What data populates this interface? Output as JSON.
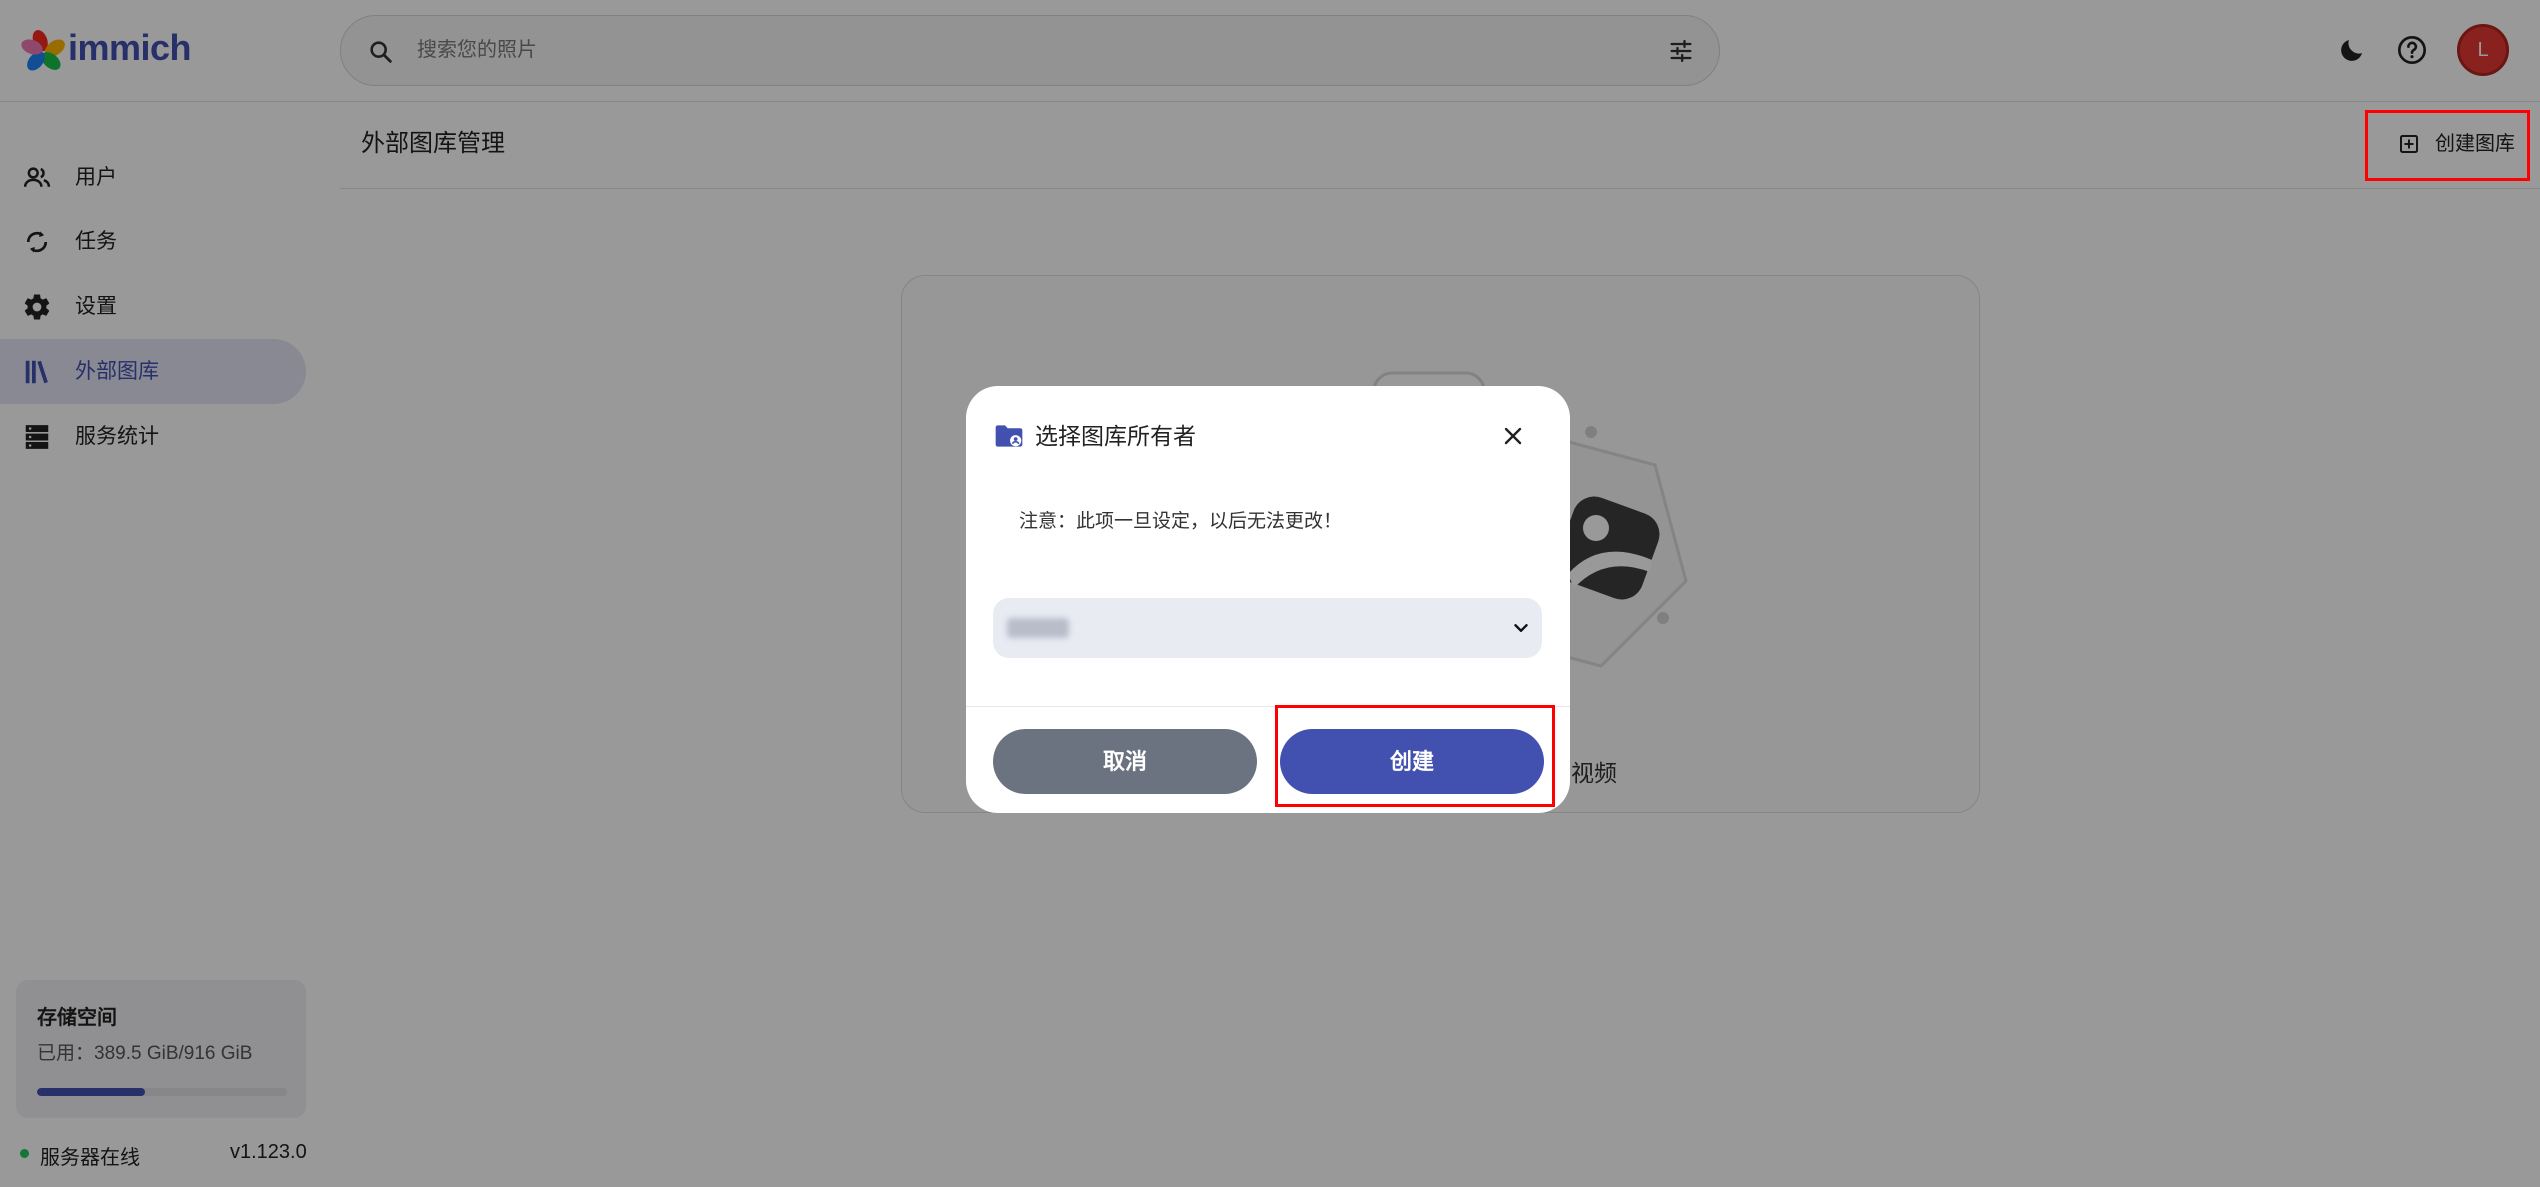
{
  "app": {
    "logo_text": "immich",
    "logo_icon": "immich-pinwheel-logo"
  },
  "header": {
    "search_placeholder": "搜索您的照片",
    "search_icon": "search-icon",
    "filter_icon": "tune-icon",
    "theme_icon": "moon-icon",
    "help_icon": "help-icon",
    "avatar_initial": "L"
  },
  "sidebar": {
    "items": [
      {
        "label": "用户",
        "icon": "users-icon",
        "active": false
      },
      {
        "label": "任务",
        "icon": "sync-icon",
        "active": false
      },
      {
        "label": "设置",
        "icon": "gear-icon",
        "active": false
      },
      {
        "label": "外部图库",
        "icon": "library-icon",
        "active": true
      },
      {
        "label": "服务统计",
        "icon": "server-icon",
        "active": false
      }
    ],
    "storage": {
      "title": "存储空间",
      "usage": "已用：389.5 GiB/916 GiB",
      "used_fraction": 0.43
    },
    "status": {
      "server": "服务器在线",
      "version": "v1.123.0"
    }
  },
  "main": {
    "title": "外部图库管理",
    "create_library_label": "创建图库",
    "empty_text_visible": "视频"
  },
  "modal": {
    "title": "选择图库所有者",
    "note": "注意：此项一旦设定，以后无法更改！",
    "cancel_label": "取消",
    "create_label": "创建"
  },
  "colors": {
    "accent": "#4250af",
    "cancel_button": "#6b7280",
    "avatar": "#e53935",
    "online": "#22c55e",
    "annotation": "#ff0000"
  }
}
